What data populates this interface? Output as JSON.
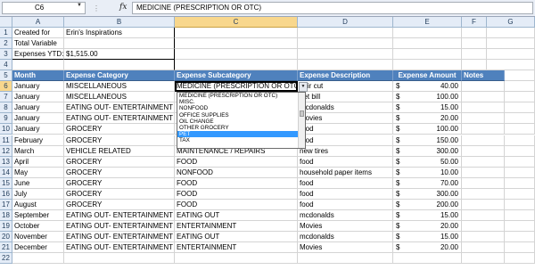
{
  "name_box": "C6",
  "formula": "MEDICINE (PRESCRIPTION OR OTC)",
  "fx_label": "fx",
  "columns": [
    "A",
    "B",
    "C",
    "D",
    "E",
    "F",
    "G"
  ],
  "info": [
    {
      "row": "1",
      "a": "Created for",
      "b": "Erin's Inspirations"
    },
    {
      "row": "2",
      "a": "Total Variable",
      "b": ""
    },
    {
      "row": "3",
      "a": "Expenses YTD:",
      "b": "$1,515.00"
    },
    {
      "row": "4",
      "a": "",
      "b": ""
    }
  ],
  "header_row": "5",
  "headers": {
    "month": "Month",
    "category": "Expense Category",
    "subcategory": "Expense Subcategory",
    "description": "Expense Description",
    "amount": "Expense Amount",
    "notes": "Notes"
  },
  "rows": [
    {
      "row": "6",
      "month": "January",
      "category": "MISCELLANEOUS",
      "subcategory": "MEDICINE (PRESCRIPTION OR OTC)",
      "description": "hair cut",
      "currency": "$",
      "amount": "40.00"
    },
    {
      "row": "7",
      "month": "January",
      "category": "MISCELLANEOUS",
      "subcategory": "",
      "description": "pet bill",
      "currency": "$",
      "amount": "100.00"
    },
    {
      "row": "8",
      "month": "January",
      "category": "EATING OUT- ENTERTAINMENT",
      "subcategory": "",
      "description": "mcdonalds",
      "currency": "$",
      "amount": "15.00"
    },
    {
      "row": "9",
      "month": "January",
      "category": "EATING OUT- ENTERTAINMENT",
      "subcategory": "",
      "description": "Movies",
      "currency": "$",
      "amount": "20.00"
    },
    {
      "row": "10",
      "month": "January",
      "category": "GROCERY",
      "subcategory": "",
      "description": "food",
      "currency": "$",
      "amount": "100.00"
    },
    {
      "row": "11",
      "month": "February",
      "category": "GROCERY",
      "subcategory": "",
      "description": "food",
      "currency": "$",
      "amount": "150.00"
    },
    {
      "row": "12",
      "month": "March",
      "category": "VEHICLE RELATED",
      "subcategory": "MAINTENANCE / REPAIRS",
      "description": "new tires",
      "currency": "$",
      "amount": "300.00"
    },
    {
      "row": "13",
      "month": "April",
      "category": "GROCERY",
      "subcategory": "FOOD",
      "description": "food",
      "currency": "$",
      "amount": "50.00"
    },
    {
      "row": "14",
      "month": "May",
      "category": "GROCERY",
      "subcategory": "NONFOOD",
      "description": "household paper items",
      "currency": "$",
      "amount": "10.00"
    },
    {
      "row": "15",
      "month": "June",
      "category": "GROCERY",
      "subcategory": "FOOD",
      "description": "food",
      "currency": "$",
      "amount": "70.00"
    },
    {
      "row": "16",
      "month": "July",
      "category": "GROCERY",
      "subcategory": "FOOD",
      "description": "food",
      "currency": "$",
      "amount": "300.00"
    },
    {
      "row": "17",
      "month": "August",
      "category": "GROCERY",
      "subcategory": "FOOD",
      "description": "food",
      "currency": "$",
      "amount": "200.00"
    },
    {
      "row": "18",
      "month": "September",
      "category": "EATING OUT- ENTERTAINMENT",
      "subcategory": "EATING OUT",
      "description": "mcdonalds",
      "currency": "$",
      "amount": "15.00"
    },
    {
      "row": "19",
      "month": "October",
      "category": "EATING OUT- ENTERTAINMENT",
      "subcategory": "ENTERTAINMENT",
      "description": "Movies",
      "currency": "$",
      "amount": "20.00"
    },
    {
      "row": "20",
      "month": "November",
      "category": "EATING OUT- ENTERTAINMENT",
      "subcategory": "EATING OUT",
      "description": "mcdonalds",
      "currency": "$",
      "amount": "15.00"
    },
    {
      "row": "21",
      "month": "December",
      "category": "EATING OUT- ENTERTAINMENT",
      "subcategory": "ENTERTAINMENT",
      "description": "Movies",
      "currency": "$",
      "amount": "20.00"
    },
    {
      "row": "22",
      "month": "",
      "category": "",
      "subcategory": "",
      "description": "",
      "currency": "",
      "amount": ""
    }
  ],
  "dropdown": {
    "items": [
      "MEDICINE (PRESCRIPTION OR OTC)",
      "MISC.",
      "NONFOOD",
      "OFFICE SUPPLIES",
      "OIL CHANGE",
      "OTHER GROCERY",
      "PET",
      "TAX"
    ],
    "selected_index": 6
  },
  "colors": {
    "header_fill": "#4f81bd",
    "header_text": "#ffffff",
    "selection_highlight": "#3399ff",
    "active_header": "#f8d78d"
  },
  "icons": [
    "dropdown-arrow-icon",
    "fx-icon"
  ]
}
